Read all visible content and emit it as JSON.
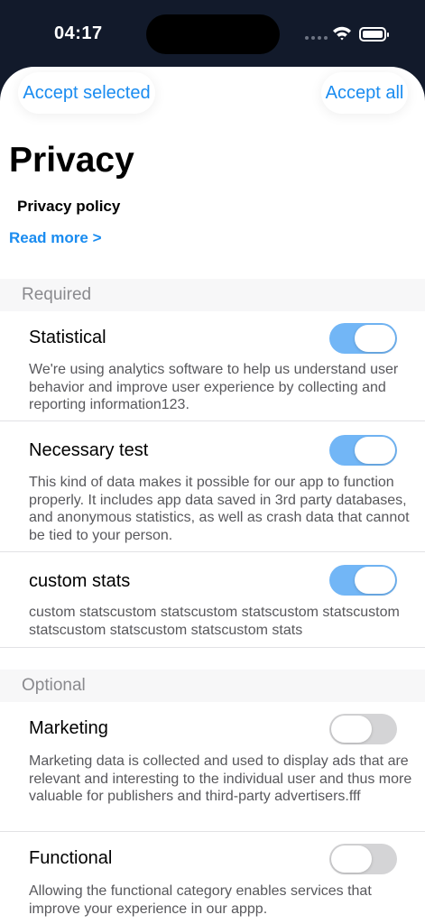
{
  "status_bar": {
    "time": "04:17"
  },
  "header": {
    "accept_selected": "Accept selected",
    "accept_all": "Accept all"
  },
  "privacy": {
    "title": "Privacy",
    "policy_label": "Privacy policy",
    "read_more": "Read more >"
  },
  "sections": {
    "required": {
      "label": "Required",
      "items": [
        {
          "title": "Statistical",
          "description": "We're using analytics software to help us understand user behavior and improve user experience by collecting and reporting information123.",
          "enabled": true
        },
        {
          "title": "Necessary test",
          "description": "This kind of data makes it possible for our app to function properly. It includes app data saved in 3rd party databases, and anonymous statistics, as well as crash data that cannot be tied to your person.",
          "enabled": true
        },
        {
          "title": "custom stats",
          "description": "custom statscustom statscustom statscustom statscustom statscustom statscustom statscustom stats",
          "enabled": true
        }
      ]
    },
    "optional": {
      "label": "Optional",
      "items": [
        {
          "title": "Marketing",
          "description": "Marketing data is collected and used to display ads that are relevant and interesting to the individual user and thus more valuable for publishers and third-party advertisers.fff",
          "enabled": false
        },
        {
          "title": "Functional",
          "description": "Allowing the functional category enables services that improve your experience in our appp.",
          "enabled": false
        }
      ]
    }
  },
  "colors": {
    "accent": "#1a8cf0",
    "toggle_on": "#72b6f6",
    "toggle_off": "#d4d4d6",
    "status_bar_bg": "#121a2b"
  }
}
